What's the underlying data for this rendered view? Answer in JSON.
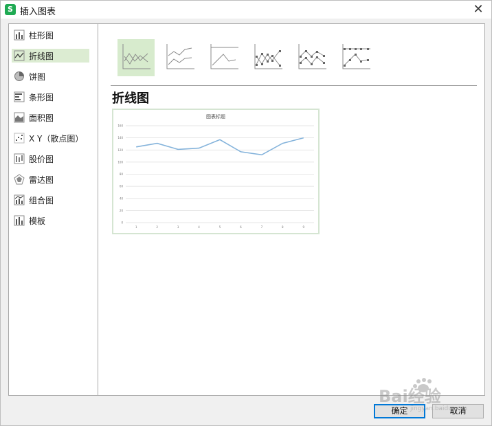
{
  "window": {
    "title": "插入图表",
    "app_icon": "S"
  },
  "sidebar": {
    "items": [
      {
        "label": "柱形图",
        "icon": "column-chart-icon"
      },
      {
        "label": "折线图",
        "icon": "line-chart-icon",
        "selected": true
      },
      {
        "label": "饼图",
        "icon": "pie-chart-icon"
      },
      {
        "label": "条形图",
        "icon": "bar-chart-icon"
      },
      {
        "label": "面积图",
        "icon": "area-chart-icon"
      },
      {
        "label": "X Y（散点图）",
        "icon": "scatter-chart-icon"
      },
      {
        "label": "股价图",
        "icon": "stock-chart-icon"
      },
      {
        "label": "雷达图",
        "icon": "radar-chart-icon"
      },
      {
        "label": "组合图",
        "icon": "combo-chart-icon"
      },
      {
        "label": "模板",
        "icon": "template-icon"
      }
    ]
  },
  "main": {
    "subtypes": [
      "line",
      "stacked-line",
      "percent-stacked-line",
      "line-with-markers",
      "stacked-line-with-markers",
      "percent-stacked-line-with-markers"
    ],
    "selected_subtype": "line",
    "heading": "折线图"
  },
  "chart_data": {
    "type": "line",
    "title": "图表标题",
    "categories": [
      "1",
      "2",
      "3",
      "4",
      "5",
      "6",
      "7",
      "8",
      "9"
    ],
    "series": [
      {
        "values": [
          125,
          131,
          121,
          123,
          137,
          117,
          112,
          131,
          140
        ]
      }
    ],
    "ylim": [
      0,
      160
    ],
    "yticks": [
      0,
      20,
      40,
      60,
      80,
      100,
      120,
      140,
      160
    ],
    "grid": true,
    "line_color": "#84b3db"
  },
  "footer": {
    "ok_label": "确定",
    "cancel_label": "取消"
  },
  "watermark": {
    "text": "Bai经验",
    "subtext": "jingyan.baidu.com"
  },
  "colors": {
    "selected_bg": "#dcecd2",
    "accent": "#0078d7"
  }
}
